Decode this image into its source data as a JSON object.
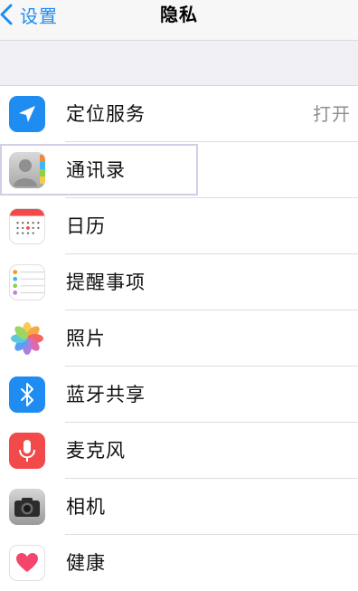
{
  "navbar": {
    "back_label": "设置",
    "title": "隐私"
  },
  "colors": {
    "accent": "#1e8cf0",
    "background": "#efeff4"
  },
  "rows": [
    {
      "label": "定位服务",
      "detail": "打开",
      "icon": "location-arrow-icon"
    },
    {
      "label": "通讯录",
      "detail": "",
      "icon": "contacts-icon"
    },
    {
      "label": "日历",
      "detail": "",
      "icon": "calendar-icon"
    },
    {
      "label": "提醒事项",
      "detail": "",
      "icon": "reminders-icon"
    },
    {
      "label": "照片",
      "detail": "",
      "icon": "photos-icon"
    },
    {
      "label": "蓝牙共享",
      "detail": "",
      "icon": "bluetooth-icon"
    },
    {
      "label": "麦克风",
      "detail": "",
      "icon": "microphone-icon"
    },
    {
      "label": "相机",
      "detail": "",
      "icon": "camera-icon"
    },
    {
      "label": "健康",
      "detail": "",
      "icon": "health-heart-icon"
    }
  ]
}
